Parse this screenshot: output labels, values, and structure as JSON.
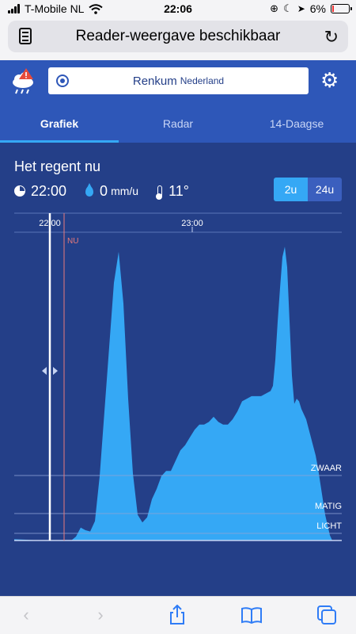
{
  "status_bar": {
    "carrier": "T-Mobile NL",
    "time": "22:06",
    "battery": "6%"
  },
  "browser": {
    "reader_text": "Reader-weergave beschikbaar"
  },
  "location": {
    "city": "Renkum",
    "country": "Nederland"
  },
  "tabs": [
    {
      "label": "Grafiek",
      "active": true
    },
    {
      "label": "Radar",
      "active": false
    },
    {
      "label": "14-Daagse",
      "active": false
    }
  ],
  "current": {
    "status": "Het regent nu",
    "time": "22:00",
    "rain_value": "0",
    "rain_unit": "mm/u",
    "temperature": "11°"
  },
  "range_toggle": {
    "options": [
      "2u",
      "24u"
    ],
    "selected": "2u"
  },
  "colors": {
    "header": "#2e57b8",
    "background": "#243f88",
    "rain_fill": "#35a8f5",
    "now_line": "#e87a7a"
  },
  "chart_data": {
    "type": "area",
    "time_ticks": [
      {
        "label": "22:00",
        "minute": 0
      },
      {
        "label": "23:00",
        "minute": 60
      }
    ],
    "now_label": "NU",
    "now_minute": 6,
    "intensity_levels": [
      "ZWAAR",
      "MATIG",
      "LICHT"
    ],
    "x": [
      -15,
      -10,
      -5,
      0,
      5,
      7,
      9,
      11,
      13,
      15,
      17,
      19,
      21,
      23,
      25,
      27,
      29,
      31,
      33,
      35,
      37,
      39,
      41,
      43,
      45,
      47,
      49,
      51,
      53,
      55,
      57,
      59,
      61,
      63,
      65,
      67,
      69,
      71,
      73,
      75,
      77,
      79,
      81,
      83,
      85,
      87,
      89,
      91,
      93,
      94,
      95,
      96,
      97,
      98,
      99,
      100,
      101,
      102,
      103,
      104,
      105,
      106,
      108,
      110,
      112,
      113,
      114,
      116,
      118,
      119,
      120,
      122,
      123
    ],
    "values": [
      0.5,
      0.3,
      0.1,
      0,
      0,
      0,
      0,
      1.5,
      5.0,
      4.0,
      3.5,
      7.5,
      25,
      50,
      75,
      100,
      112,
      92,
      55,
      26,
      10,
      7,
      9,
      16,
      20,
      25,
      27,
      27,
      31,
      35,
      37,
      40,
      43,
      45,
      45,
      46,
      48,
      46,
      45,
      45,
      47,
      50,
      54,
      55,
      56,
      56,
      56,
      57,
      58,
      60,
      70,
      85,
      98,
      110,
      114,
      106,
      85,
      64,
      53,
      55,
      54,
      51,
      47,
      40,
      33,
      28,
      22,
      10,
      2,
      0,
      0,
      0,
      0
    ],
    "value_max": 115,
    "grid": true
  }
}
